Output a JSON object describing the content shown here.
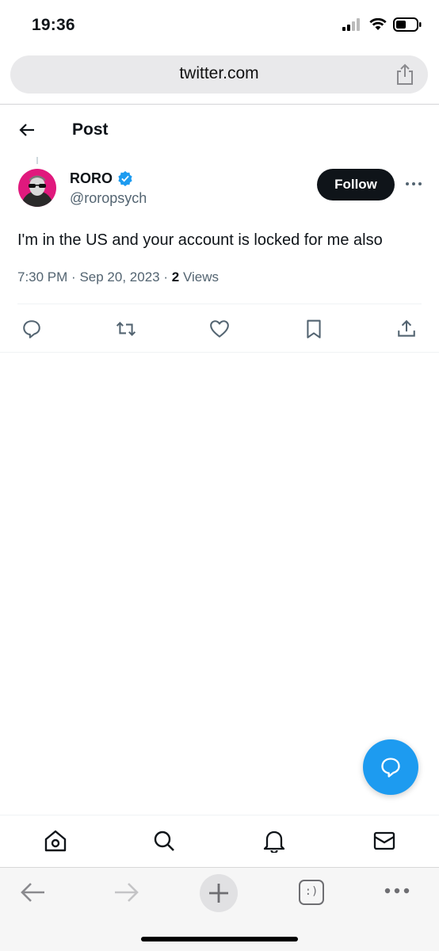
{
  "status_bar": {
    "time": "19:36",
    "icons": [
      "cellular-signal-icon",
      "wifi-icon",
      "battery-icon"
    ]
  },
  "browser": {
    "url": "twitter.com",
    "share_icon": "share-icon"
  },
  "header": {
    "title": "Post",
    "back_icon": "back-arrow-icon"
  },
  "tweet": {
    "author_name": "RORO",
    "verified": true,
    "author_handle": "@roropsych",
    "follow_label": "Follow",
    "text": "I'm in the US and your account is locked for me also",
    "time": "7:30 PM",
    "date": "Sep 20, 2023",
    "separator": "·",
    "views_count": "2",
    "views_label": "Views",
    "actions": [
      "reply-icon",
      "retweet-icon",
      "like-icon",
      "bookmark-icon",
      "share-icon"
    ]
  },
  "fab": {
    "icon": "compose-reply-icon"
  },
  "tab_bar": {
    "items": [
      "home-icon",
      "search-icon",
      "notifications-icon",
      "messages-icon"
    ]
  },
  "safari_toolbar": {
    "items": [
      "back-icon",
      "forward-icon",
      "new-tab-icon",
      "tabs-icon",
      "more-icon"
    ],
    "tabs_label": ":)"
  },
  "colors": {
    "accent": "#1d9bf0",
    "text": "#0f1419",
    "secondary_text": "#536471",
    "follow_bg": "#0f1419",
    "avatar_bg": "#e0197d"
  }
}
